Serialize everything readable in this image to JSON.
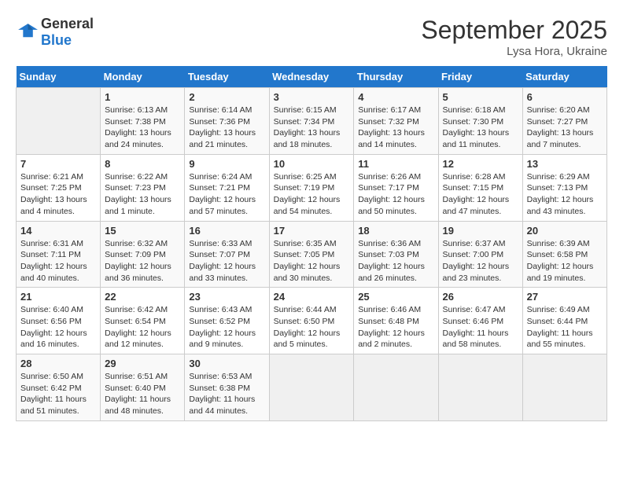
{
  "header": {
    "logo_general": "General",
    "logo_blue": "Blue",
    "month_title": "September 2025",
    "subtitle": "Lysa Hora, Ukraine"
  },
  "days_of_week": [
    "Sunday",
    "Monday",
    "Tuesday",
    "Wednesday",
    "Thursday",
    "Friday",
    "Saturday"
  ],
  "weeks": [
    [
      {
        "day": "",
        "empty": true
      },
      {
        "day": "1",
        "sunrise": "Sunrise: 6:13 AM",
        "sunset": "Sunset: 7:38 PM",
        "daylight": "Daylight: 13 hours and 24 minutes."
      },
      {
        "day": "2",
        "sunrise": "Sunrise: 6:14 AM",
        "sunset": "Sunset: 7:36 PM",
        "daylight": "Daylight: 13 hours and 21 minutes."
      },
      {
        "day": "3",
        "sunrise": "Sunrise: 6:15 AM",
        "sunset": "Sunset: 7:34 PM",
        "daylight": "Daylight: 13 hours and 18 minutes."
      },
      {
        "day": "4",
        "sunrise": "Sunrise: 6:17 AM",
        "sunset": "Sunset: 7:32 PM",
        "daylight": "Daylight: 13 hours and 14 minutes."
      },
      {
        "day": "5",
        "sunrise": "Sunrise: 6:18 AM",
        "sunset": "Sunset: 7:30 PM",
        "daylight": "Daylight: 13 hours and 11 minutes."
      },
      {
        "day": "6",
        "sunrise": "Sunrise: 6:20 AM",
        "sunset": "Sunset: 7:27 PM",
        "daylight": "Daylight: 13 hours and 7 minutes."
      }
    ],
    [
      {
        "day": "7",
        "sunrise": "Sunrise: 6:21 AM",
        "sunset": "Sunset: 7:25 PM",
        "daylight": "Daylight: 13 hours and 4 minutes."
      },
      {
        "day": "8",
        "sunrise": "Sunrise: 6:22 AM",
        "sunset": "Sunset: 7:23 PM",
        "daylight": "Daylight: 13 hours and 1 minute."
      },
      {
        "day": "9",
        "sunrise": "Sunrise: 6:24 AM",
        "sunset": "Sunset: 7:21 PM",
        "daylight": "Daylight: 12 hours and 57 minutes."
      },
      {
        "day": "10",
        "sunrise": "Sunrise: 6:25 AM",
        "sunset": "Sunset: 7:19 PM",
        "daylight": "Daylight: 12 hours and 54 minutes."
      },
      {
        "day": "11",
        "sunrise": "Sunrise: 6:26 AM",
        "sunset": "Sunset: 7:17 PM",
        "daylight": "Daylight: 12 hours and 50 minutes."
      },
      {
        "day": "12",
        "sunrise": "Sunrise: 6:28 AM",
        "sunset": "Sunset: 7:15 PM",
        "daylight": "Daylight: 12 hours and 47 minutes."
      },
      {
        "day": "13",
        "sunrise": "Sunrise: 6:29 AM",
        "sunset": "Sunset: 7:13 PM",
        "daylight": "Daylight: 12 hours and 43 minutes."
      }
    ],
    [
      {
        "day": "14",
        "sunrise": "Sunrise: 6:31 AM",
        "sunset": "Sunset: 7:11 PM",
        "daylight": "Daylight: 12 hours and 40 minutes."
      },
      {
        "day": "15",
        "sunrise": "Sunrise: 6:32 AM",
        "sunset": "Sunset: 7:09 PM",
        "daylight": "Daylight: 12 hours and 36 minutes."
      },
      {
        "day": "16",
        "sunrise": "Sunrise: 6:33 AM",
        "sunset": "Sunset: 7:07 PM",
        "daylight": "Daylight: 12 hours and 33 minutes."
      },
      {
        "day": "17",
        "sunrise": "Sunrise: 6:35 AM",
        "sunset": "Sunset: 7:05 PM",
        "daylight": "Daylight: 12 hours and 30 minutes."
      },
      {
        "day": "18",
        "sunrise": "Sunrise: 6:36 AM",
        "sunset": "Sunset: 7:03 PM",
        "daylight": "Daylight: 12 hours and 26 minutes."
      },
      {
        "day": "19",
        "sunrise": "Sunrise: 6:37 AM",
        "sunset": "Sunset: 7:00 PM",
        "daylight": "Daylight: 12 hours and 23 minutes."
      },
      {
        "day": "20",
        "sunrise": "Sunrise: 6:39 AM",
        "sunset": "Sunset: 6:58 PM",
        "daylight": "Daylight: 12 hours and 19 minutes."
      }
    ],
    [
      {
        "day": "21",
        "sunrise": "Sunrise: 6:40 AM",
        "sunset": "Sunset: 6:56 PM",
        "daylight": "Daylight: 12 hours and 16 minutes."
      },
      {
        "day": "22",
        "sunrise": "Sunrise: 6:42 AM",
        "sunset": "Sunset: 6:54 PM",
        "daylight": "Daylight: 12 hours and 12 minutes."
      },
      {
        "day": "23",
        "sunrise": "Sunrise: 6:43 AM",
        "sunset": "Sunset: 6:52 PM",
        "daylight": "Daylight: 12 hours and 9 minutes."
      },
      {
        "day": "24",
        "sunrise": "Sunrise: 6:44 AM",
        "sunset": "Sunset: 6:50 PM",
        "daylight": "Daylight: 12 hours and 5 minutes."
      },
      {
        "day": "25",
        "sunrise": "Sunrise: 6:46 AM",
        "sunset": "Sunset: 6:48 PM",
        "daylight": "Daylight: 12 hours and 2 minutes."
      },
      {
        "day": "26",
        "sunrise": "Sunrise: 6:47 AM",
        "sunset": "Sunset: 6:46 PM",
        "daylight": "Daylight: 11 hours and 58 minutes."
      },
      {
        "day": "27",
        "sunrise": "Sunrise: 6:49 AM",
        "sunset": "Sunset: 6:44 PM",
        "daylight": "Daylight: 11 hours and 55 minutes."
      }
    ],
    [
      {
        "day": "28",
        "sunrise": "Sunrise: 6:50 AM",
        "sunset": "Sunset: 6:42 PM",
        "daylight": "Daylight: 11 hours and 51 minutes."
      },
      {
        "day": "29",
        "sunrise": "Sunrise: 6:51 AM",
        "sunset": "Sunset: 6:40 PM",
        "daylight": "Daylight: 11 hours and 48 minutes."
      },
      {
        "day": "30",
        "sunrise": "Sunrise: 6:53 AM",
        "sunset": "Sunset: 6:38 PM",
        "daylight": "Daylight: 11 hours and 44 minutes."
      },
      {
        "day": "",
        "empty": true
      },
      {
        "day": "",
        "empty": true
      },
      {
        "day": "",
        "empty": true
      },
      {
        "day": "",
        "empty": true
      }
    ]
  ]
}
